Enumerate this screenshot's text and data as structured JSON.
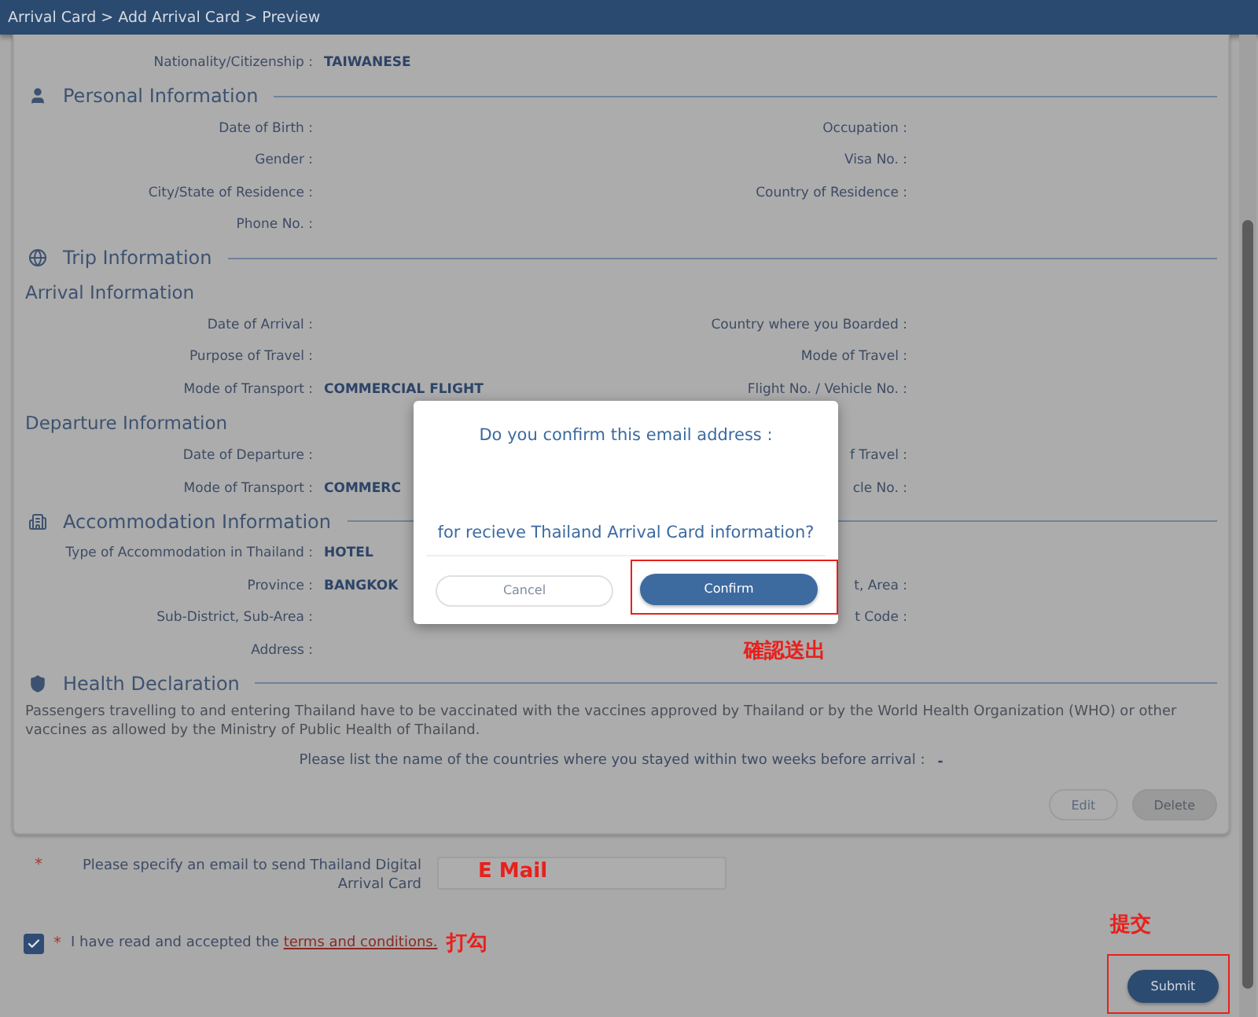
{
  "breadcrumb": "Arrival Card > Add Arrival Card > Preview",
  "nationality": {
    "label": "Nationality/Citizenship :",
    "value": "TAIWANESE"
  },
  "sections": [
    {
      "kind": "person",
      "title": "Personal Information",
      "groups": [
        {
          "rows": [
            {
              "left": {
                "label": "Date of Birth :"
              },
              "right": {
                "label": "Occupation :"
              }
            },
            {
              "left": {
                "label": "Gender :"
              },
              "right": {
                "label": "Visa No. :"
              }
            },
            {
              "left": {
                "label": "City/State of Residence :"
              },
              "right": {
                "label": "Country of Residence :"
              }
            },
            {
              "left": {
                "label": "Phone No. :"
              }
            }
          ]
        }
      ]
    },
    {
      "kind": "trip",
      "title": "Trip Information",
      "groups": [
        {
          "title": "Arrival Information",
          "rows": [
            {
              "left": {
                "label": "Date of Arrival :"
              },
              "right": {
                "label": "Country where you Boarded :"
              }
            },
            {
              "left": {
                "label": "Purpose of Travel :"
              },
              "right": {
                "label": "Mode of Travel :"
              }
            },
            {
              "left": {
                "label": "Mode of Transport :",
                "value": "COMMERCIAL FLIGHT"
              },
              "right": {
                "label": "Flight No. / Vehicle No. :"
              }
            }
          ]
        },
        {
          "title": "Departure Information",
          "rows": [
            {
              "left": {
                "label": "Date of Departure :"
              },
              "right": {
                "label": "f Travel :"
              }
            },
            {
              "left": {
                "label": "Mode of Transport :",
                "value": "COMMERC"
              },
              "right": {
                "label": "cle No. :"
              }
            }
          ]
        }
      ]
    },
    {
      "kind": "accommodation",
      "title": "Accommodation Information",
      "groups": [
        {
          "rows": [
            {
              "left": {
                "label": "Type of Accommodation in Thailand :",
                "value": "HOTEL"
              }
            },
            {
              "left": {
                "label": "Province :",
                "value": "BANGKOK"
              },
              "right": {
                "label": "t, Area :"
              }
            },
            {
              "left": {
                "label": "Sub-District, Sub-Area :"
              },
              "right": {
                "label": "t Code :"
              }
            },
            {
              "left": {
                "label": "Address :"
              }
            }
          ]
        }
      ]
    },
    {
      "kind": "health",
      "title": "Health Declaration",
      "paragraph": "Passengers travelling to and entering Thailand have to be vaccinated with the vaccines approved by Thailand or by the World Health Organization (WHO) or other vaccines as allowed by the Ministry of Public Health of Thailand.",
      "question": {
        "label": "Please list the name of the countries where you stayed within two weeks before arrival :",
        "value": "-"
      }
    }
  ],
  "card_buttons": [
    {
      "label": "Edit",
      "disabled": false
    },
    {
      "label": "Delete",
      "disabled": true
    }
  ],
  "email": {
    "required": "*",
    "label": "Please specify an email to send Thailand Digital Arrival Card",
    "note": "E Mail"
  },
  "terms": {
    "required": "*",
    "checked": true,
    "text": "I have read and accepted the",
    "link": "terms and conditions.",
    "note": "打勾"
  },
  "submit": {
    "label": "Submit",
    "highlighted": true,
    "note": "提交"
  },
  "dialog": {
    "question": "Do you confirm this email address :",
    "purpose": "for recieve Thailand Arrival Card information?",
    "buttons": [
      {
        "label": "Cancel",
        "kind": "secondary",
        "highlighted": false
      },
      {
        "label": "Confirm",
        "kind": "primary",
        "highlighted": true
      }
    ],
    "note": "確認送出"
  }
}
